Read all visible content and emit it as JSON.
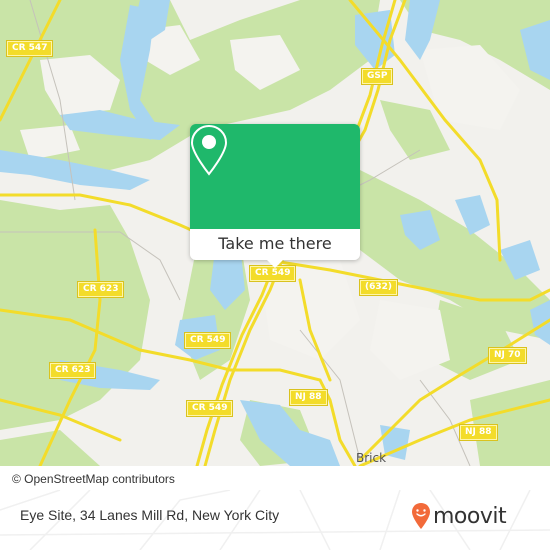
{
  "map": {
    "road_labels": [
      {
        "id": "cr547",
        "text": "CR 547"
      },
      {
        "id": "gsp",
        "text": "GSP"
      },
      {
        "id": "cr549-top",
        "text": "CR 549"
      },
      {
        "id": "cr632",
        "text": "(632)"
      },
      {
        "id": "cr623-a",
        "text": "CR 623"
      },
      {
        "id": "cr549-mid",
        "text": "CR 549"
      },
      {
        "id": "cr623-b",
        "text": "CR 623"
      },
      {
        "id": "nj70",
        "text": "NJ 70"
      },
      {
        "id": "nj88-a",
        "text": "NJ 88"
      },
      {
        "id": "cr549-low",
        "text": "CR 549"
      },
      {
        "id": "nj88-b",
        "text": "NJ 88"
      }
    ],
    "place_labels": [
      {
        "id": "brick",
        "text": "Brick"
      }
    ],
    "colors": {
      "land": "#f2f1ed",
      "forest": "#c9e4a7",
      "water": "#a8d5f0",
      "road": "#f3dc2a"
    }
  },
  "popup": {
    "icon": "map-pin-icon",
    "button_label": "Take me there",
    "color": "#1fb86b"
  },
  "attribution": "© OpenStreetMap contributors",
  "footer": {
    "address": "Eye Site, 34 Lanes Mill Rd, New York City",
    "logo_text": "moovit",
    "logo_color": "#f26a3a"
  }
}
